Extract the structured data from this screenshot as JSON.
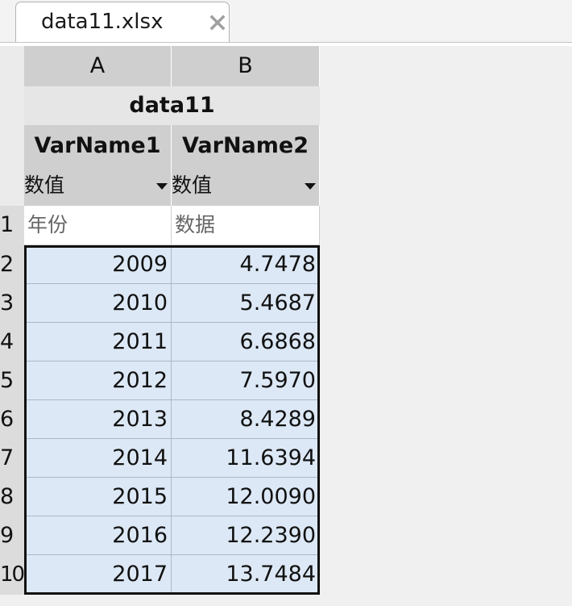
{
  "tab": {
    "filename": "data11.xlsx"
  },
  "table": {
    "columns": [
      "A",
      "B"
    ],
    "title": "data11",
    "var_names": [
      "VarName1",
      "VarName2"
    ],
    "var_types": [
      "数值",
      "数值"
    ],
    "rows": [
      {
        "num": "1",
        "cells": [
          "年份",
          "数据"
        ]
      },
      {
        "num": "2",
        "cells": [
          "2009",
          "4.7478"
        ]
      },
      {
        "num": "3",
        "cells": [
          "2010",
          "5.4687"
        ]
      },
      {
        "num": "4",
        "cells": [
          "2011",
          "6.6868"
        ]
      },
      {
        "num": "5",
        "cells": [
          "2012",
          "7.5970"
        ]
      },
      {
        "num": "6",
        "cells": [
          "2013",
          "8.4289"
        ]
      },
      {
        "num": "7",
        "cells": [
          "2014",
          "11.6394"
        ]
      },
      {
        "num": "8",
        "cells": [
          "2015",
          "12.0090"
        ]
      },
      {
        "num": "9",
        "cells": [
          "2016",
          "12.2390"
        ]
      },
      {
        "num": "10",
        "cells": [
          "2017",
          "13.7484"
        ]
      }
    ]
  },
  "colors": {
    "selection_fill": "#dce8f5",
    "header_gray": "#cfcfcf"
  }
}
